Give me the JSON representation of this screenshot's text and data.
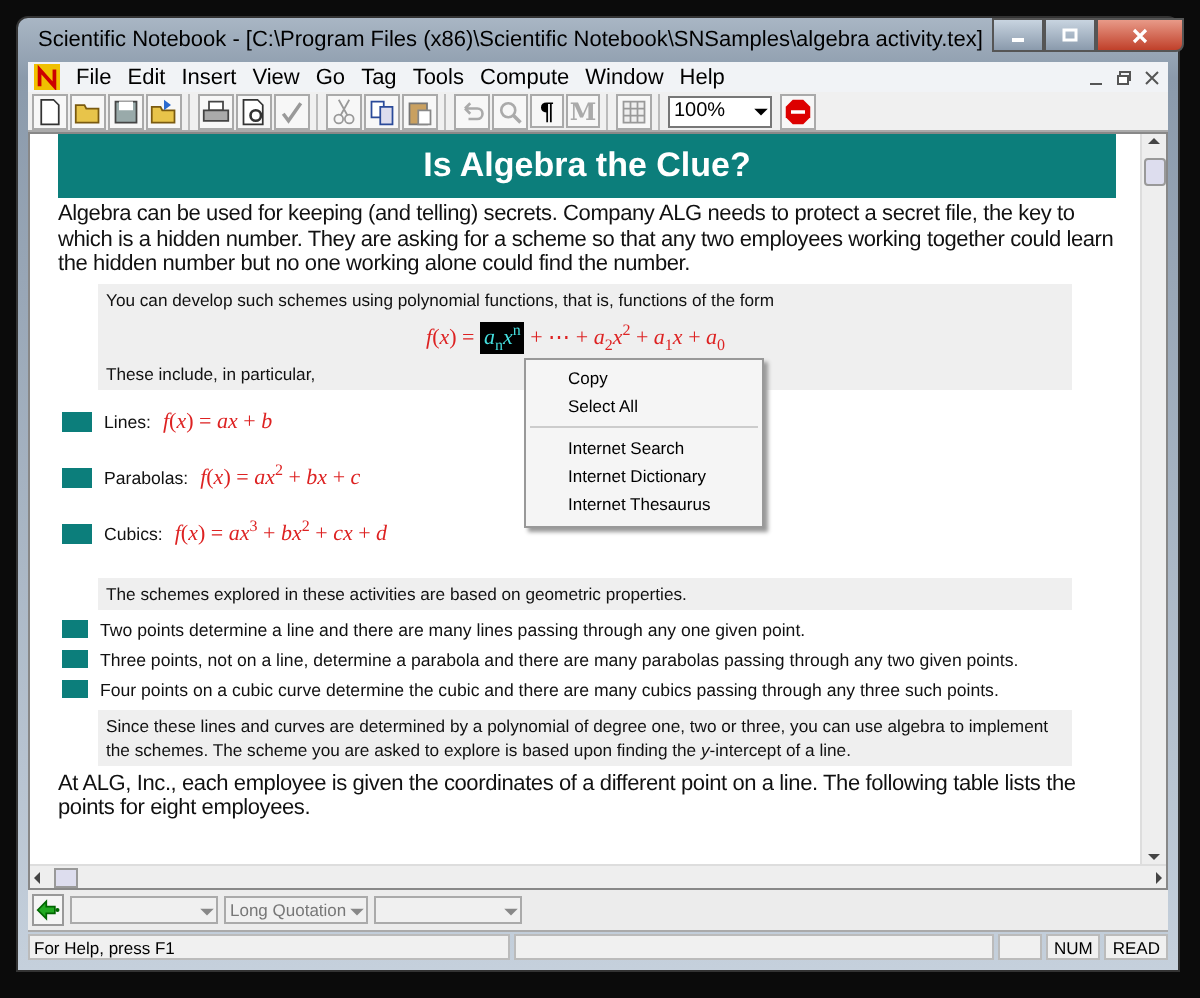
{
  "window": {
    "title": "Scientific Notebook - [C:\\Program Files (x86)\\Scientific Notebook\\SNSamples\\algebra activity.tex]"
  },
  "menu": [
    "File",
    "Edit",
    "Insert",
    "View",
    "Go",
    "Tag",
    "Tools",
    "Compute",
    "Window",
    "Help"
  ],
  "toolbar": {
    "glyph_buttons": [
      {
        "text": "¶",
        "disabled": false
      },
      {
        "text": "M",
        "disabled": true
      }
    ],
    "zoom": "100%"
  },
  "document": {
    "heading": "Is Algebra the Clue?",
    "blocks": [
      {
        "kind": "para",
        "text": "Algebra can be used for keeping (and telling) secrets. Company ALG needs to protect a secret file, the key to which is a hidden number. They are asking for a scheme so that any two employees working together could learn the hidden number but no one working alone could find the number."
      },
      {
        "kind": "note",
        "lines": [
          {
            "kind": "text",
            "text": "You can develop such schemes using polynomial functions, that is, functions of the form"
          },
          {
            "kind": "formula",
            "parts": [
              {
                "text": "*f*(*x*) = ",
                "selected": false
              },
              {
                "text": "*a*$_{n}$*x*$^{n}$",
                "selected": true
              },
              {
                "text": " + ⋯ + *a*$_{2}$*x*$^{2}$ + *a*$_{1}$*x* + *a*$_{0}$",
                "selected": false
              }
            ]
          },
          {
            "kind": "text",
            "text": "These include, in particular,"
          }
        ]
      },
      {
        "kind": "bullet",
        "label": "Lines:",
        "formula": "*f*(*x*) = *ax* + *b*"
      },
      {
        "kind": "bullet",
        "label": "Parabolas:",
        "formula": "*f*(*x*) = *ax*$^{2}$ + *bx* + *c*"
      },
      {
        "kind": "bullet",
        "label": "Cubics:",
        "formula": "*f*(*x*) = *ax*$^{3}$ + *bx*$^{2}$ + *cx* + *d*"
      },
      {
        "kind": "note",
        "lines": [
          {
            "kind": "text",
            "text": "The schemes explored in these activities are based on geometric properties."
          }
        ]
      },
      {
        "kind": "fact",
        "text": "Two points determine a line and there are many lines passing through any one given point."
      },
      {
        "kind": "fact",
        "text": "Three points, not on a line, determine a parabola and there are many parabolas passing through any two given points."
      },
      {
        "kind": "fact",
        "text": "Four points on a cubic curve determine the cubic and there are many cubics passing through any three such points."
      },
      {
        "kind": "note",
        "lines": [
          {
            "kind": "text",
            "text": "Since these lines and curves are determined by a polynomial of degree one, two or three, you can use algebra to implement the schemes. The scheme you are asked to explore is based upon finding the *y*-intercept of a line."
          }
        ]
      },
      {
        "kind": "para",
        "text": "At ALG, Inc., each employee is given the coordinates of a different point on a line. The following table lists the points for eight employees."
      }
    ]
  },
  "context_menu": [
    {
      "label": "Copy",
      "separator_before": false
    },
    {
      "label": "Select All",
      "separator_before": false
    },
    {
      "label": "Internet Search",
      "separator_before": true
    },
    {
      "label": "Internet Dictionary",
      "separator_before": false
    },
    {
      "label": "Internet Thesaurus",
      "separator_before": false
    }
  ],
  "format_bar": {
    "style_field": "Long Quotation"
  },
  "status_bar": {
    "help": "For Help, press F1",
    "indicators": [
      "NUM",
      "READ"
    ]
  }
}
